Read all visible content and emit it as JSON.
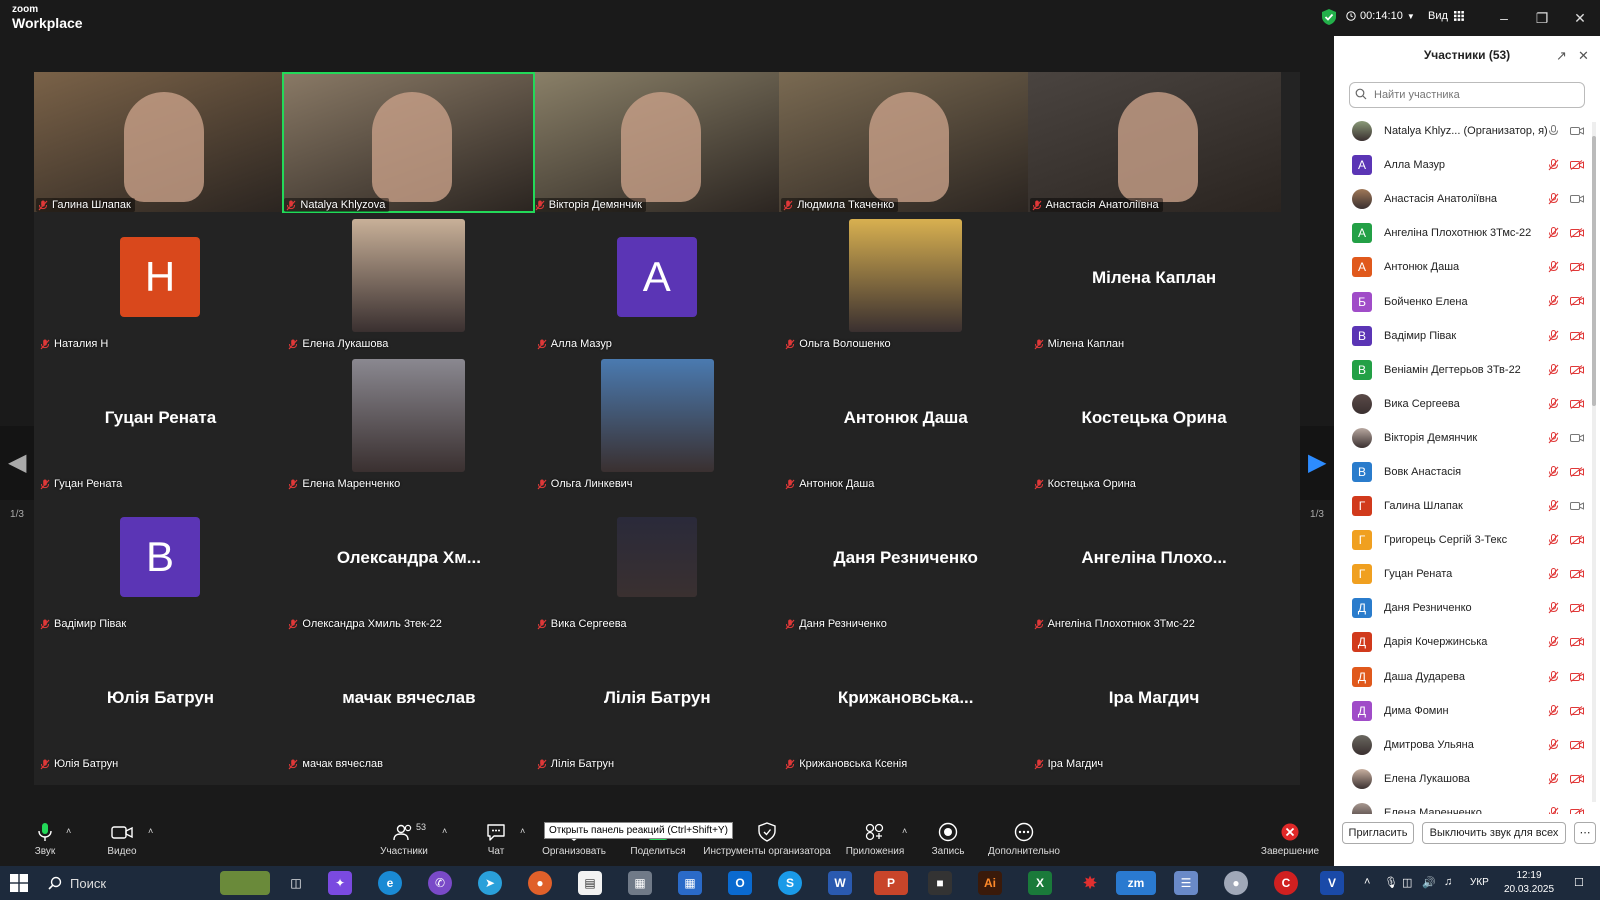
{
  "app": {
    "logo_line1": "zoom",
    "logo_line2": "Workplace"
  },
  "titlebar": {
    "timer": "00:14:10",
    "view_label": "Вид"
  },
  "video_tiles": [
    {
      "name": "Галина Шлапак",
      "type": "camera"
    },
    {
      "name": "Natalya Khlyzova",
      "type": "camera",
      "active": true
    },
    {
      "name": "Вікторія Демянчик",
      "type": "camera"
    },
    {
      "name": "Людмила Ткаченко",
      "type": "camera"
    },
    {
      "name": "Анастасія Анатоліївна",
      "type": "camera"
    },
    {
      "name": "Наталия Н",
      "type": "avatar",
      "letter": "Н",
      "color": "#d9481c"
    },
    {
      "name": "Елена Лукашова",
      "type": "photo"
    },
    {
      "name": "Алла Мазур",
      "type": "avatar",
      "letter": "А",
      "color": "#5b35b5"
    },
    {
      "name": "Ольга Волошенко",
      "type": "photo"
    },
    {
      "name": "Мілена Каплан",
      "type": "text",
      "display": "Мілена Каплан"
    },
    {
      "name": "Гуцан Рената",
      "type": "text",
      "display": "Гуцан Рената"
    },
    {
      "name": "Елена Маренченко",
      "type": "photo"
    },
    {
      "name": "Ольга Линкевич",
      "type": "photo"
    },
    {
      "name": "Антонюк Даша",
      "type": "text",
      "display": "Антонюк Даша"
    },
    {
      "name": "Костецька Орина",
      "type": "text",
      "display": "Костецька Орина"
    },
    {
      "name": "Вадімир Півак",
      "type": "avatar",
      "letter": "В",
      "color": "#5b35b5"
    },
    {
      "name": "Олександра Хмиль 3тек-22",
      "type": "text",
      "display": "Олександра Хм..."
    },
    {
      "name": "Вика Сергеева",
      "type": "photo"
    },
    {
      "name": "Даня Резниченко",
      "type": "text",
      "display": "Даня Резниченко"
    },
    {
      "name": "Ангеліна Плохотнюк 3Тмс-22",
      "type": "text",
      "display": "Ангеліна Плохо..."
    },
    {
      "name": "Юлія Батрун",
      "type": "text",
      "display": "Юлія Батрун"
    },
    {
      "name": "мачак вячеслав",
      "type": "text",
      "display": "мачак вячеслав"
    },
    {
      "name": "Лілія Батрун",
      "type": "text",
      "display": "Лілія Батрун"
    },
    {
      "name": "Крижановська Ксенія",
      "type": "text",
      "display": "Крижановська..."
    },
    {
      "name": "Іра Магдич",
      "type": "text",
      "display": "Іра Магдич"
    }
  ],
  "pager": {
    "left_label": "1/3",
    "right_label": "1/3"
  },
  "toolbar": {
    "audio": "Звук",
    "video": "Видео",
    "participants": "Участники",
    "participants_count": "53",
    "chat": "Чат",
    "organize": "Организовать",
    "share": "Поделиться",
    "host_tools": "Инструменты организатора",
    "apps": "Приложения",
    "record": "Запись",
    "more": "Дополнительно",
    "end": "Завершение",
    "tooltip": "Открыть панель реакций (Ctrl+Shift+Y)"
  },
  "panel": {
    "title": "Участники (53)",
    "search_placeholder": "Найти участника",
    "invite": "Пригласить",
    "mute_all": "Выключить звук для всех",
    "participants": [
      {
        "name": "Natalya Khlyz... (Организатор, я)",
        "avatar": "photo",
        "mic": "on",
        "cam": "on"
      },
      {
        "name": "Алла Мазур",
        "letter": "А",
        "color": "#5b35b5"
      },
      {
        "name": "Анастасія Анатоліївна",
        "avatar": "photo",
        "cam": "on"
      },
      {
        "name": "Ангеліна Плохотнюк 3Тмс-22",
        "letter": "А",
        "color": "#23a046"
      },
      {
        "name": "Антонюк Даша",
        "letter": "А",
        "color": "#e0591c"
      },
      {
        "name": "Бойченко Елена",
        "letter": "Б",
        "color": "#a04cc8"
      },
      {
        "name": "Вадімир Півак",
        "letter": "В",
        "color": "#5b35b5"
      },
      {
        "name": "Веніамін Дегтерьов 3Тв-22",
        "letter": "В",
        "color": "#23a046"
      },
      {
        "name": "Вика Сергеева",
        "avatar": "photo"
      },
      {
        "name": "Вікторія Демянчик",
        "avatar": "photo",
        "cam": "on"
      },
      {
        "name": "Вовк Анастасія",
        "letter": "В",
        "color": "#2a7ccc"
      },
      {
        "name": "Галина Шлапак",
        "letter": "Г",
        "color": "#d13a1c",
        "cam": "on"
      },
      {
        "name": "Григорець Сергій 3-Текс",
        "letter": "Г",
        "color": "#f0a020"
      },
      {
        "name": "Гуцан Рената",
        "letter": "Г",
        "color": "#f0a020"
      },
      {
        "name": "Даня Резниченко",
        "letter": "Д",
        "color": "#2a7ccc"
      },
      {
        "name": "Дарія Кочержинська",
        "letter": "Д",
        "color": "#d13a1c"
      },
      {
        "name": "Даша Дударева",
        "letter": "Д",
        "color": "#e0591c"
      },
      {
        "name": "Дима Фомин",
        "letter": "Д",
        "color": "#a04cc8"
      },
      {
        "name": "Дмитрова Ульяна",
        "avatar": "photo"
      },
      {
        "name": "Елена Лукашова",
        "avatar": "photo"
      },
      {
        "name": "Елена Маренченко",
        "avatar": "photo"
      }
    ]
  },
  "taskbar": {
    "search_label": "Поиск",
    "lang": "УКР",
    "time": "12:19",
    "date": "20.03.2025"
  }
}
